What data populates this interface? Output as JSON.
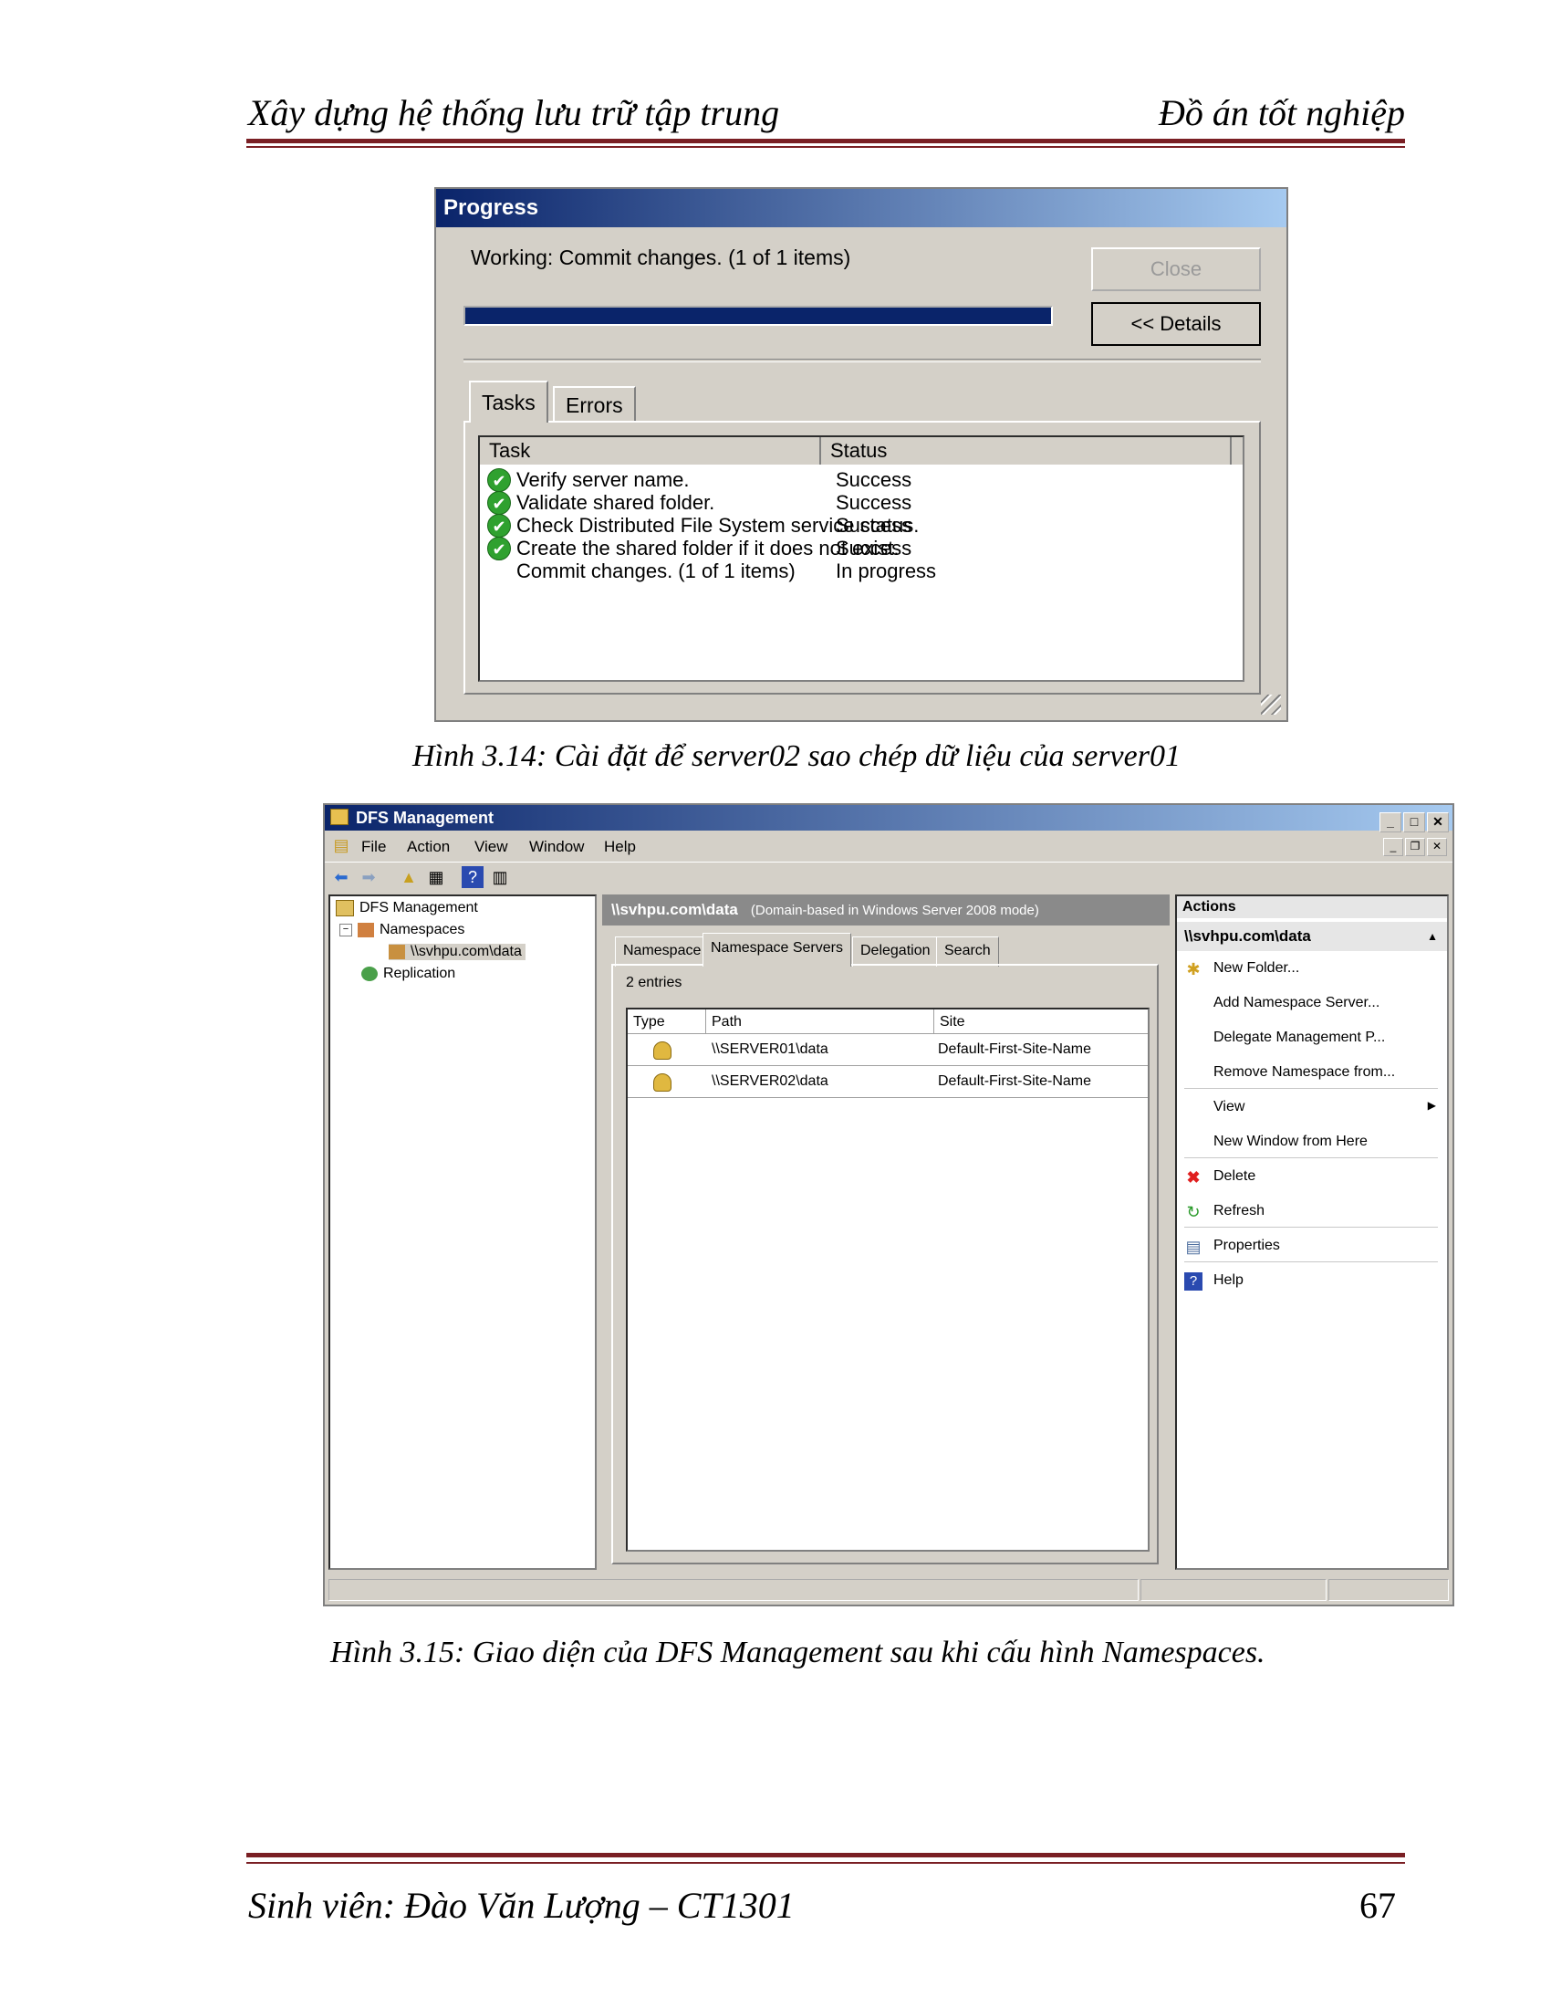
{
  "page": {
    "header_left": "Xây dựng hệ thống lưu trữ tập trung",
    "header_right": "Đồ án tốt nghiệp",
    "footer_left": "Sinh viên: Đào Văn Lượng – CT1301",
    "page_number": "67",
    "caption_1": "Hình 3.14: Cài đặt  để server02 sao chép dữ liệu của server01",
    "caption_2": "Hình 3.15: Giao diện của DFS Management sau khi cấu hình Namespaces."
  },
  "progress_dialog": {
    "title": "Progress",
    "working_text": "Working: Commit changes. (1 of 1 items)",
    "progress_fraction": 1.0,
    "close_label": "Close",
    "details_label": "<< Details",
    "tabs": [
      "Tasks",
      "Errors"
    ],
    "columns": [
      "Task",
      "Status"
    ],
    "rows": [
      {
        "task": "Verify server name.",
        "status": "Success",
        "done": true
      },
      {
        "task": "Validate shared folder.",
        "status": "Success",
        "done": true
      },
      {
        "task": "Check Distributed File System service status.",
        "status": "Success",
        "done": true
      },
      {
        "task": "Create the shared folder if it does not exist.",
        "status": "Success",
        "done": true
      },
      {
        "task": "Commit changes. (1 of 1 items)",
        "status": "In progress",
        "done": false
      }
    ]
  },
  "dfs_window": {
    "title": "DFS Management",
    "menu": [
      "File",
      "Action",
      "View",
      "Window",
      "Help"
    ],
    "tree": {
      "root": "DFS Management",
      "namespaces": "Namespaces",
      "namespace_item": "\\\\svhpu.com\\data",
      "replication": "Replication"
    },
    "center": {
      "header_path": "\\\\svhpu.com\\data",
      "header_mode": "(Domain-based in Windows Server 2008 mode)",
      "tabs": [
        "Namespace",
        "Namespace Servers",
        "Delegation",
        "Search"
      ],
      "entries": "2 entries",
      "columns": [
        "Type",
        "Path",
        "Site"
      ],
      "rows": [
        {
          "path": "\\\\SERVER01\\data",
          "site": "Default-First-Site-Name"
        },
        {
          "path": "\\\\SERVER02\\data",
          "site": "Default-First-Site-Name"
        }
      ]
    },
    "actions": {
      "header": "Actions",
      "subheader": "\\\\svhpu.com\\data",
      "items": [
        "New Folder...",
        "Add Namespace Server...",
        "Delegate Management P...",
        "Remove Namespace from...",
        "View",
        "New Window from Here",
        "Delete",
        "Refresh",
        "Properties",
        "Help"
      ]
    }
  }
}
